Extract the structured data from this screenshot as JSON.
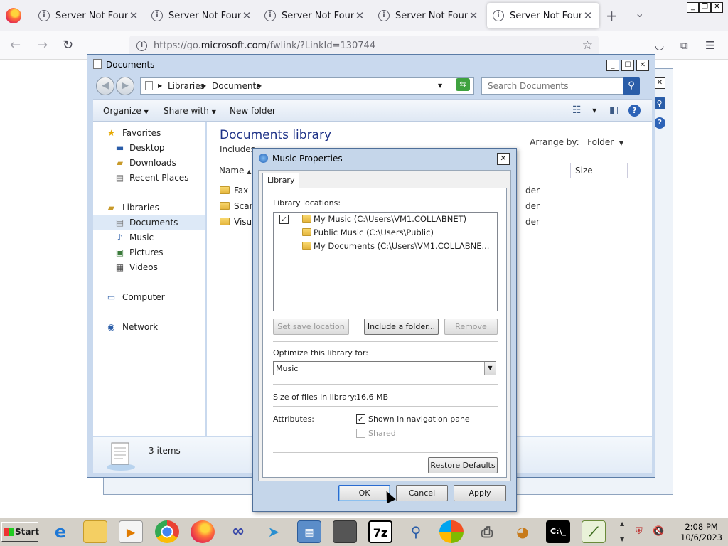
{
  "browser": {
    "tabs": [
      {
        "title": "Server Not Found"
      },
      {
        "title": "Server Not Found"
      },
      {
        "title": "Server Not Found"
      },
      {
        "title": "Server Not Found"
      },
      {
        "title": "Server Not Found"
      }
    ],
    "url_prefix": "https://go.",
    "url_domain": "microsoft.com",
    "url_suffix": "/fwlink/?LinkId=130744"
  },
  "explorer": {
    "title": "Documents",
    "breadcrumb": [
      "Libraries",
      "Documents"
    ],
    "search_placeholder": "Search Documents",
    "toolbar": {
      "organize": "Organize",
      "share_with": "Share with",
      "new_folder": "New folder"
    },
    "nav": {
      "favorites": "Favorites",
      "desktop": "Desktop",
      "downloads": "Downloads",
      "recent_places": "Recent Places",
      "libraries": "Libraries",
      "documents": "Documents",
      "music": "Music",
      "pictures": "Pictures",
      "videos": "Videos",
      "computer": "Computer",
      "network": "Network"
    },
    "library_title": "Documents library",
    "library_sub": "Includes",
    "arrange_label": "Arrange by:",
    "arrange_value": "Folder",
    "columns": {
      "name": "Name",
      "size": "Size"
    },
    "files": [
      {
        "name": "Fax",
        "type": "der"
      },
      {
        "name": "Scan",
        "type": "der"
      },
      {
        "name": "Visu",
        "type": "der"
      }
    ],
    "item_count": "3 items"
  },
  "dialog": {
    "title": "Music Properties",
    "tab": "Library",
    "locations_label": "Library locations:",
    "locations": [
      {
        "label": "My Music (C:\\Users\\VM1.COLLABNET)",
        "checked": true
      },
      {
        "label": "Public Music (C:\\Users\\Public)",
        "checked": false
      },
      {
        "label": "My Documents (C:\\Users\\VM1.COLLABNE...",
        "checked": false
      }
    ],
    "set_save_location": "Set save location",
    "include_folder": "Include a folder...",
    "remove": "Remove",
    "optimize_label": "Optimize this library for:",
    "optimize_value": "Music",
    "size_label": "Size of files in library:",
    "size_value": "16.6 MB",
    "attributes_label": "Attributes:",
    "shown_in_nav": "Shown in navigation pane",
    "shared": "Shared",
    "restore_defaults": "Restore Defaults",
    "ok": "OK",
    "cancel": "Cancel",
    "apply": "Apply"
  },
  "taskbar": {
    "start": "Start",
    "seven_zip": "7z",
    "time": "2:08 PM",
    "date": "10/6/2023"
  }
}
